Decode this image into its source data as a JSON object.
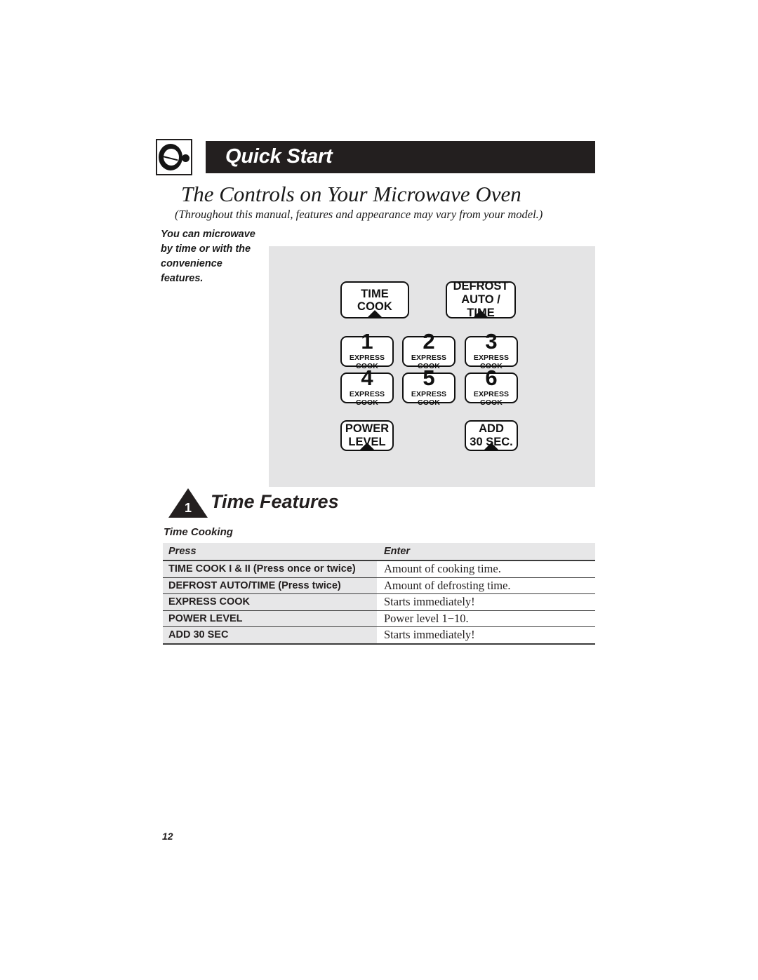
{
  "header": {
    "chapter_icon": "microwave-dial-icon",
    "chapter_title": "Quick Start",
    "section_title": "The Controls on Your Microwave Oven",
    "section_subtitle": "(Throughout this manual, features and appearance may vary from your model.)"
  },
  "side_note": {
    "text": "You can microwave by time or with the convenience features."
  },
  "control_panel": {
    "background_color": "#e4e4e5",
    "buttons": [
      {
        "name": "time-cook",
        "lines": [
          "TIME COOK"
        ],
        "type": "text"
      },
      {
        "name": "defrost-auto-time",
        "lines": [
          "DEFROST",
          "AUTO / TIME"
        ],
        "type": "text"
      },
      {
        "name": "express-cook-1",
        "number": "1",
        "sub": "EXPRESS COOK",
        "type": "number"
      },
      {
        "name": "express-cook-2",
        "number": "2",
        "sub": "EXPRESS COOK",
        "type": "number"
      },
      {
        "name": "express-cook-3",
        "number": "3",
        "sub": "EXPRESS COOK",
        "type": "number"
      },
      {
        "name": "express-cook-4",
        "number": "4",
        "sub": "EXPRESS COOK",
        "type": "number"
      },
      {
        "name": "express-cook-5",
        "number": "5",
        "sub": "EXPRESS COOK",
        "type": "number"
      },
      {
        "name": "express-cook-6",
        "number": "6",
        "sub": "EXPRESS COOK",
        "type": "number"
      },
      {
        "name": "power-level",
        "lines": [
          "POWER",
          "LEVEL"
        ],
        "type": "text"
      },
      {
        "name": "add-30-sec",
        "lines": [
          "ADD",
          "30 SEC."
        ],
        "type": "text"
      }
    ]
  },
  "feature_section": {
    "number": "1",
    "title": "Time Features",
    "table_caption": "Time Cooking"
  },
  "table": {
    "headers": [
      "Press",
      "Enter"
    ],
    "rows": [
      [
        "TIME COOK I & II (Press once or twice)",
        "Amount of cooking time."
      ],
      [
        "DEFROST AUTO/TIME (Press twice)",
        "Amount of defrosting time."
      ],
      [
        "EXPRESS COOK",
        "Starts immediately!"
      ],
      [
        "POWER LEVEL",
        "Power level 1−10."
      ],
      [
        "ADD 30 SEC",
        "Starts immediately!"
      ]
    ]
  },
  "footer": {
    "page_number": "12"
  }
}
